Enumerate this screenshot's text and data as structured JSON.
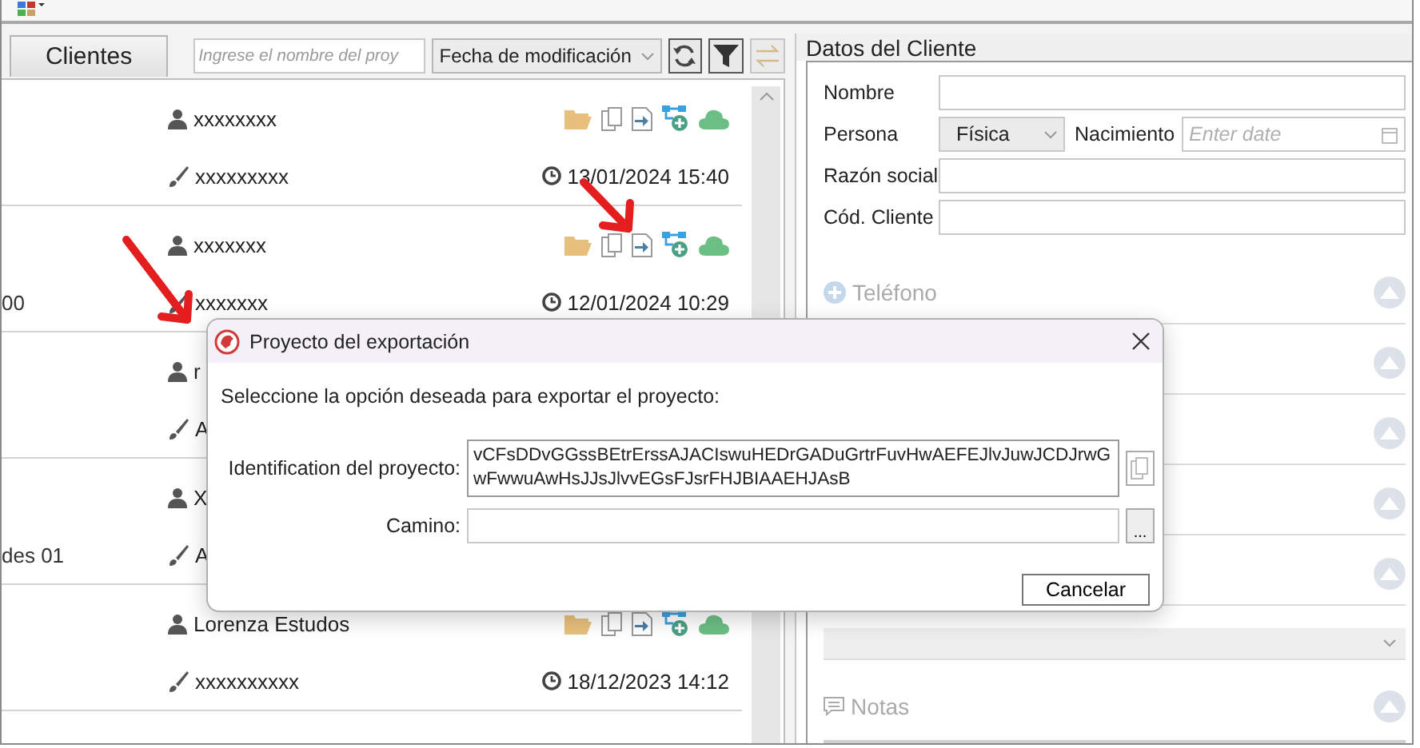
{
  "left_panel": {
    "tab": {
      "label": "Clientes"
    },
    "search": {
      "placeholder": "Ingrese el nombre del proy"
    },
    "sort": {
      "value": "Fecha de modificación"
    },
    "buttons": [
      {
        "kind": "refresh",
        "disabled": false
      },
      {
        "kind": "filter",
        "disabled": false
      },
      {
        "kind": "swap",
        "disabled": true
      }
    ]
  },
  "rows": [
    {
      "name": "xxxxxxxx",
      "subtitle": "xxxxxxxxx",
      "date": "13/01/2024 15:40"
    },
    {
      "name": "xxxxxxx",
      "subtitle": "xxxxxxx",
      "date": "12/01/2024 10:29",
      "left_text": "00"
    },
    {
      "name": "r",
      "subtitle": "A"
    },
    {
      "name": "X",
      "subtitle": "A",
      "left_text": "des 01"
    },
    {
      "name": "Lorenza Estudos",
      "subtitle": "xxxxxxxxxx",
      "date": "18/12/2023 14:12"
    }
  ],
  "client_panel": {
    "title": "Datos del Cliente",
    "nombre": {
      "label": "Nombre"
    },
    "persona": {
      "label": "Persona",
      "value": "Física"
    },
    "nacimiento": {
      "label": "Nacimiento",
      "placeholder": "Enter date"
    },
    "razon_social": {
      "label": "Razón social"
    },
    "codigo": {
      "label": "Cód. Cliente"
    },
    "sections": [
      {
        "label": "Teléfono",
        "expanded": true
      },
      {
        "expanded": true
      },
      {
        "expanded": true
      },
      {
        "expanded": true
      },
      {
        "expanded": true
      }
    ],
    "notes": {
      "label": "Notas",
      "expanded": true
    }
  },
  "dialog": {
    "title": "Proyecto del exportación",
    "message": "Seleccione la opción deseada para exportar el proyecto:",
    "id_label": "Identification del proyecto:",
    "id_value": "vCFsDDvGGssBEtrErssAJACIswuHEDrGADuGrtrFuvHwAEFEJlvJuwJCDJrwGwFwwuAwHsJJsJlvvEGsFJsrFHJBIAAEHJAsB",
    "path_label": "Camino:",
    "browse": "...",
    "cancel": "Cancelar"
  }
}
